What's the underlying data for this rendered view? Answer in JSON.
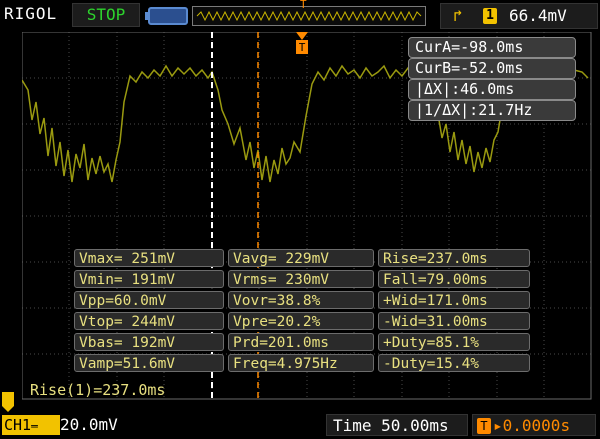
{
  "header": {
    "brand": "RIGOL",
    "run_status": "STOP",
    "trigger": {
      "slope_icon": "rising-edge-icon",
      "channel": "1",
      "level": "66.4mV",
      "color": "#f2c200"
    }
  },
  "cursors": {
    "cur_a": "CurA=-98.0ms",
    "cur_b": "CurB=-52.0ms",
    "delta_x": "|ΔX|:46.0ms",
    "inv_delta_x": "|1/ΔX|:21.7Hz"
  },
  "measurements": [
    [
      "Vmax= 251mV",
      "Vavg= 229mV",
      "Rise=237.0ms"
    ],
    [
      "Vmin= 191mV",
      "Vrms= 230mV",
      "Fall=79.00ms"
    ],
    [
      "Vpp=60.0mV",
      "Vovr=38.8%",
      "+Wid=171.0ms"
    ],
    [
      "Vtop= 244mV",
      "Vpre=20.2%",
      "-Wid=31.00ms"
    ],
    [
      "Vbas= 192mV",
      "Prd=201.0ms",
      "+Duty=85.1%"
    ],
    [
      "Vamp=51.6mV",
      "Freq=4.975Hz",
      "-Duty=15.4%"
    ]
  ],
  "rise_readout": "Rise(1)=237.0ms",
  "footer": {
    "channel_label": "CH1",
    "channel_scale": "20.0mV",
    "time_label": "Time",
    "time_value": "50.00ms",
    "trigger_offset": "0.0000s",
    "offset_badge": "T"
  },
  "markers": {
    "trigger_position": "T"
  },
  "colors": {
    "trace": "#9a9a10",
    "grid": "#4a4a4a",
    "cursor_a": "#ffffff",
    "cursor_b": "#ff8a00",
    "accent_yellow": "#f2c200"
  }
}
